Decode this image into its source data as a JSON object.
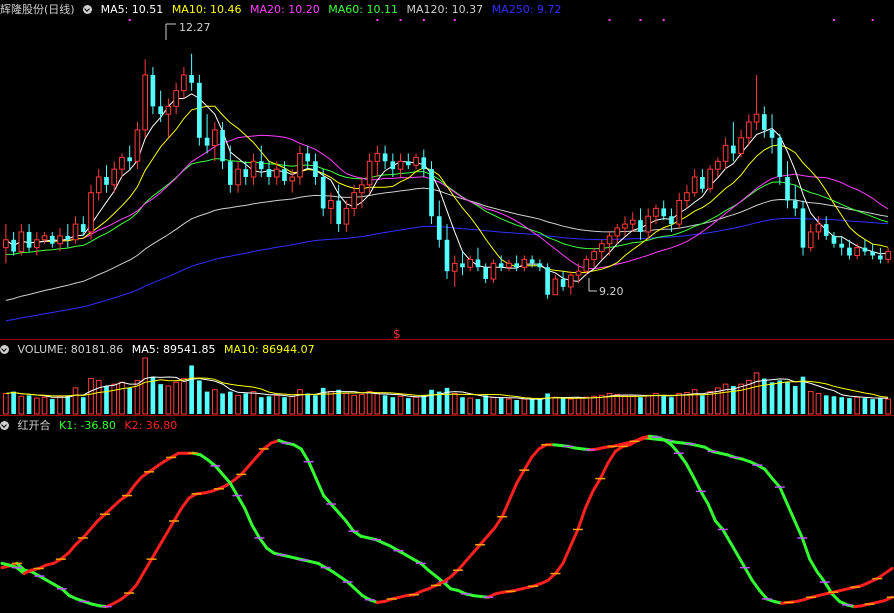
{
  "colors": {
    "up": "#ff3b3b",
    "down": "#53ffff",
    "ma5": "#ffffff",
    "ma10": "#ffff00",
    "ma20": "#ff40ff",
    "ma60": "#40ff40",
    "ma120": "#cfcfcf",
    "ma250": "#3030ff",
    "k1": "#33ff33",
    "k2": "#ff2020",
    "orangeMark": "#ffa000",
    "magentaMark": "#c050ff",
    "sep": "#a00000",
    "label": "#d0d0d0"
  },
  "icons": {
    "collapse": "chevron-down-circle-icon"
  },
  "main_header": {
    "title": "辉隆股份(日线)",
    "ma5": "MA5: 10.51",
    "ma10": "MA10: 10.46",
    "ma20": "MA20: 10.20",
    "ma60": "MA60: 10.11",
    "ma120": "MA120: 10.37",
    "ma250": "MA250: 9.72"
  },
  "volume_header": {
    "title": "VOLUME: 80181.86",
    "ma5": "MA5: 89541.85",
    "ma10": "MA10: 86944.07"
  },
  "indicator_header": {
    "title": "红开合",
    "k1": "K1: -36.80",
    "k2": "K2: 36.80"
  },
  "annotations": {
    "high_label": "12.27",
    "low_label": "9.20",
    "marker": "$"
  },
  "chart_data": [
    {
      "type": "candlestick",
      "y_range": [
        8.7,
        12.7
      ],
      "candles": [
        [
          9.8,
          10.1,
          9.6,
          9.9
        ],
        [
          9.9,
          10.0,
          9.7,
          9.75
        ],
        [
          9.75,
          10.1,
          9.7,
          10.0
        ],
        [
          10.0,
          10.1,
          9.75,
          9.8
        ],
        [
          9.8,
          10.0,
          9.7,
          9.9
        ],
        [
          9.9,
          10.0,
          9.85,
          9.95
        ],
        [
          9.95,
          10.0,
          9.8,
          9.85
        ],
        [
          9.85,
          10.05,
          9.75,
          9.95
        ],
        [
          9.95,
          10.1,
          9.8,
          9.9
        ],
        [
          9.9,
          10.2,
          9.85,
          10.1
        ],
        [
          10.1,
          10.2,
          9.95,
          10.0
        ],
        [
          10.0,
          10.6,
          9.9,
          10.5
        ],
        [
          10.5,
          10.8,
          10.4,
          10.7
        ],
        [
          10.7,
          10.85,
          10.5,
          10.6
        ],
        [
          10.6,
          10.9,
          10.5,
          10.8
        ],
        [
          10.8,
          11.0,
          10.7,
          10.95
        ],
        [
          10.95,
          11.1,
          10.8,
          10.9
        ],
        [
          10.9,
          11.4,
          10.8,
          11.3
        ],
        [
          11.3,
          12.2,
          11.2,
          12.0
        ],
        [
          12.0,
          12.1,
          11.5,
          11.6
        ],
        [
          11.6,
          11.8,
          11.4,
          11.5
        ],
        [
          11.5,
          11.7,
          11.2,
          11.6
        ],
        [
          11.6,
          11.9,
          11.5,
          11.8
        ],
        [
          11.8,
          12.1,
          11.7,
          12.0
        ],
        [
          12.0,
          12.27,
          11.8,
          11.9
        ],
        [
          11.9,
          12.0,
          11.1,
          11.2
        ],
        [
          11.2,
          11.5,
          11.0,
          11.1
        ],
        [
          11.1,
          11.4,
          10.9,
          11.3
        ],
        [
          11.3,
          11.4,
          10.8,
          10.9
        ],
        [
          10.9,
          11.1,
          10.5,
          10.6
        ],
        [
          10.6,
          10.9,
          10.5,
          10.8
        ],
        [
          10.8,
          10.9,
          10.6,
          10.7
        ],
        [
          10.7,
          11.0,
          10.6,
          10.9
        ],
        [
          10.9,
          11.1,
          10.7,
          10.8
        ],
        [
          10.8,
          10.9,
          10.6,
          10.7
        ],
        [
          10.7,
          10.9,
          10.6,
          10.8
        ],
        [
          10.8,
          10.9,
          10.6,
          10.65
        ],
        [
          10.65,
          10.8,
          10.5,
          10.7
        ],
        [
          10.7,
          11.1,
          10.6,
          11.0
        ],
        [
          11.0,
          11.1,
          10.8,
          10.9
        ],
        [
          10.9,
          11.0,
          10.6,
          10.7
        ],
        [
          10.7,
          10.8,
          10.2,
          10.3
        ],
        [
          10.3,
          10.5,
          10.1,
          10.4
        ],
        [
          10.4,
          10.6,
          10.0,
          10.1
        ],
        [
          10.1,
          10.4,
          10.0,
          10.3
        ],
        [
          10.3,
          10.6,
          10.2,
          10.5
        ],
        [
          10.5,
          10.7,
          10.3,
          10.6
        ],
        [
          10.6,
          11.0,
          10.5,
          10.9
        ],
        [
          10.9,
          11.1,
          10.7,
          11.0
        ],
        [
          11.0,
          11.1,
          10.8,
          10.9
        ],
        [
          10.9,
          11.0,
          10.7,
          10.8
        ],
        [
          10.8,
          11.0,
          10.7,
          10.9
        ],
        [
          10.9,
          11.0,
          10.8,
          10.85
        ],
        [
          10.85,
          11.0,
          10.8,
          10.95
        ],
        [
          10.95,
          11.05,
          10.7,
          10.8
        ],
        [
          10.8,
          10.9,
          10.1,
          10.2
        ],
        [
          10.2,
          10.4,
          9.8,
          9.9
        ],
        [
          9.9,
          10.1,
          9.4,
          9.5
        ],
        [
          9.5,
          9.7,
          9.3,
          9.6
        ],
        [
          9.6,
          9.75,
          9.45,
          9.55
        ],
        [
          9.55,
          9.7,
          9.5,
          9.65
        ],
        [
          9.65,
          9.8,
          9.5,
          9.55
        ],
        [
          9.55,
          9.6,
          9.35,
          9.4
        ],
        [
          9.4,
          9.65,
          9.35,
          9.6
        ],
        [
          9.6,
          9.7,
          9.5,
          9.55
        ],
        [
          9.55,
          9.65,
          9.5,
          9.6
        ],
        [
          9.6,
          9.7,
          9.5,
          9.55
        ],
        [
          9.55,
          9.7,
          9.5,
          9.65
        ],
        [
          9.65,
          9.7,
          9.55,
          9.6
        ],
        [
          9.6,
          9.65,
          9.5,
          9.55
        ],
        [
          9.55,
          9.6,
          9.15,
          9.2
        ],
        [
          9.2,
          9.45,
          9.2,
          9.4
        ],
        [
          9.4,
          9.5,
          9.25,
          9.3
        ],
        [
          9.3,
          9.5,
          9.2,
          9.45
        ],
        [
          9.45,
          9.6,
          9.35,
          9.5
        ],
        [
          9.5,
          9.7,
          9.45,
          9.65
        ],
        [
          9.65,
          9.8,
          9.55,
          9.75
        ],
        [
          9.75,
          9.9,
          9.65,
          9.85
        ],
        [
          9.85,
          10.0,
          9.7,
          9.95
        ],
        [
          9.95,
          10.1,
          9.85,
          10.05
        ],
        [
          10.05,
          10.2,
          9.95,
          10.1
        ],
        [
          10.1,
          10.25,
          10.0,
          10.15
        ],
        [
          10.15,
          10.3,
          9.9,
          10.0
        ],
        [
          10.0,
          10.3,
          9.9,
          10.2
        ],
        [
          10.2,
          10.35,
          10.1,
          10.3
        ],
        [
          10.3,
          10.4,
          10.15,
          10.2
        ],
        [
          10.2,
          10.3,
          10.0,
          10.1
        ],
        [
          10.1,
          10.5,
          10.05,
          10.4
        ],
        [
          10.4,
          10.6,
          10.3,
          10.5
        ],
        [
          10.5,
          10.8,
          10.45,
          10.7
        ],
        [
          10.7,
          10.8,
          10.5,
          10.55
        ],
        [
          10.55,
          10.85,
          10.5,
          10.8
        ],
        [
          10.8,
          10.95,
          10.7,
          10.9
        ],
        [
          10.9,
          11.2,
          10.8,
          11.1
        ],
        [
          11.1,
          11.4,
          10.9,
          11.0
        ],
        [
          11.0,
          11.3,
          10.95,
          11.2
        ],
        [
          11.2,
          11.5,
          11.1,
          11.4
        ],
        [
          11.4,
          12.0,
          11.3,
          11.5
        ],
        [
          11.5,
          11.6,
          11.2,
          11.3
        ],
        [
          11.3,
          11.5,
          11.0,
          11.2
        ],
        [
          11.2,
          11.25,
          10.6,
          10.7
        ],
        [
          10.7,
          10.9,
          10.3,
          10.4
        ],
        [
          10.4,
          10.6,
          10.2,
          10.3
        ],
        [
          10.3,
          10.4,
          9.7,
          9.8
        ],
        [
          9.8,
          10.1,
          9.75,
          10.0
        ],
        [
          10.0,
          10.2,
          9.9,
          10.1
        ],
        [
          10.1,
          10.2,
          9.9,
          9.95
        ],
        [
          9.95,
          10.0,
          9.8,
          9.85
        ],
        [
          9.85,
          9.95,
          9.7,
          9.8
        ],
        [
          9.8,
          9.9,
          9.65,
          9.7
        ],
        [
          9.7,
          9.85,
          9.65,
          9.8
        ],
        [
          9.8,
          9.9,
          9.7,
          9.75
        ],
        [
          9.75,
          9.85,
          9.65,
          9.7
        ],
        [
          9.7,
          9.8,
          9.6,
          9.65
        ],
        [
          9.65,
          9.8,
          9.6,
          9.75
        ]
      ],
      "ma60_start": 9.7,
      "ma120_start": 9.1,
      "ma250_start": 8.85
    },
    {
      "type": "bar",
      "y_range": [
        0,
        300000
      ],
      "values": [
        110000,
        120000,
        95000,
        100000,
        85000,
        90000,
        80000,
        95000,
        100000,
        140000,
        90000,
        190000,
        180000,
        150000,
        160000,
        170000,
        140000,
        180000,
        300000,
        200000,
        160000,
        150000,
        170000,
        190000,
        260000,
        180000,
        120000,
        130000,
        110000,
        120000,
        100000,
        110000,
        120000,
        90000,
        95000,
        100000,
        90000,
        95000,
        130000,
        110000,
        100000,
        140000,
        120000,
        130000,
        110000,
        100000,
        105000,
        120000,
        110000,
        100000,
        90000,
        95000,
        85000,
        90000,
        100000,
        130000,
        120000,
        140000,
        110000,
        90000,
        85000,
        80000,
        100000,
        90000,
        85000,
        80000,
        75000,
        80000,
        78000,
        80000,
        110000,
        90000,
        85000,
        80000,
        85000,
        90000,
        95000,
        100000,
        110000,
        105000,
        100000,
        95000,
        90000,
        100000,
        110000,
        95000,
        90000,
        110000,
        115000,
        130000,
        100000,
        120000,
        140000,
        160000,
        150000,
        160000,
        180000,
        220000,
        190000,
        170000,
        180000,
        170000,
        150000,
        200000,
        120000,
        110000,
        100000,
        95000,
        90000,
        85000,
        90000,
        85000,
        80000,
        85000,
        80181.86
      ]
    },
    {
      "type": "line",
      "y_range": [
        -105,
        105
      ],
      "series": [
        {
          "name": "K1",
          "values": [
            -55,
            -53,
            -50,
            -58,
            -60,
            -65,
            -70,
            -75,
            -80,
            -88,
            -92,
            -95,
            -98,
            -100,
            -101,
            -97,
            -92,
            -85,
            -75,
            -60,
            -45,
            -30,
            -15,
            0,
            15,
            27,
            32,
            33,
            35,
            38,
            42,
            48,
            55,
            65,
            75,
            85,
            92,
            95,
            92,
            90,
            85,
            70,
            50,
            30,
            20,
            10,
            0,
            -12,
            -18,
            -20,
            -22,
            -26,
            -30,
            -35,
            -40,
            -45,
            -50,
            -58,
            -65,
            -72,
            -80,
            -82,
            -86,
            -88,
            -89,
            -90,
            -86,
            -84,
            -83,
            -81,
            -79,
            -77,
            -74,
            -70,
            -62,
            -50,
            -30,
            -10,
            15,
            35,
            50,
            68,
            82,
            88,
            90,
            95,
            98,
            97,
            96,
            95,
            93,
            92,
            91,
            89,
            87,
            82,
            80,
            78,
            75,
            73,
            70,
            66,
            61,
            50,
            40,
            20,
            0,
            -20,
            -45,
            -60,
            -72,
            -86,
            -95,
            -99,
            -101,
            -100,
            -98,
            -96,
            -94,
            -90
          ]
        },
        {
          "name": "K2",
          "values": [
            -50,
            -52,
            -55,
            -62,
            -58,
            -56,
            -52,
            -50,
            -45,
            -38,
            -28,
            -20,
            -10,
            0,
            8,
            16,
            24,
            30,
            42,
            52,
            58,
            64,
            70,
            75,
            80,
            80,
            80,
            78,
            72,
            65,
            55,
            45,
            30,
            15,
            -5,
            -20,
            -32,
            -38,
            -40,
            -42,
            -44,
            -46,
            -48,
            -50,
            -55,
            -60,
            -66,
            -72,
            -80,
            -88,
            -93,
            -96,
            -95,
            -92,
            -90,
            -88,
            -87,
            -83,
            -80,
            -76,
            -72,
            -66,
            -58,
            -48,
            -38,
            -28,
            -18,
            -8,
            5,
            25,
            45,
            60,
            75,
            85,
            90,
            90,
            89,
            88,
            86,
            85,
            84,
            85,
            87,
            88,
            90,
            92,
            94,
            98,
            100,
            99,
            96,
            90,
            80,
            68,
            52,
            35,
            20,
            0,
            -10,
            -25,
            -40,
            -55,
            -70,
            -82,
            -92,
            -95,
            -97,
            -96,
            -95,
            -93,
            -90,
            -88,
            -86,
            -84,
            -82,
            -80,
            -78,
            -76,
            -72,
            -68,
            -62,
            -56
          ]
        }
      ]
    }
  ]
}
